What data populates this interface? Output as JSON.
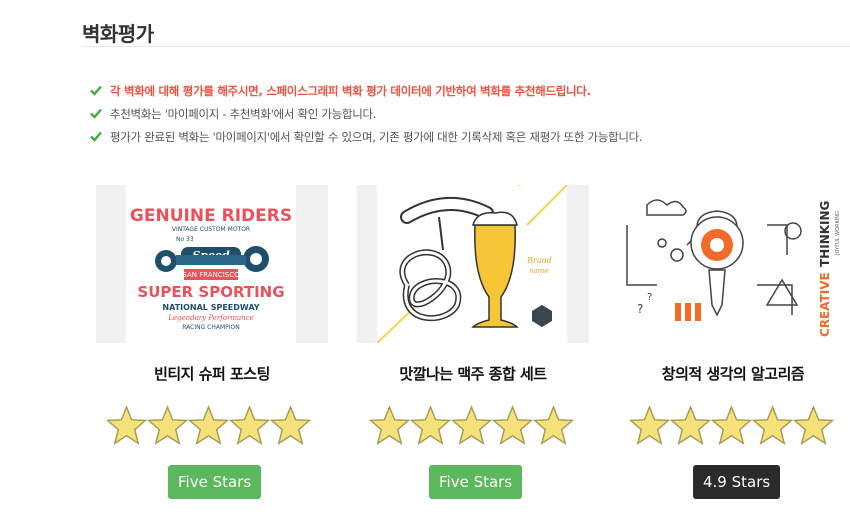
{
  "page": {
    "title": "벽화평가"
  },
  "notices": [
    {
      "text": "각 벽화에 대해 평가를 해주시면, 스페이스그래피 벽화 평가 데이터에 기반하여 벽화를 추천해드립니다.",
      "highlight": true
    },
    {
      "text": "추천벽화는 '마이페이지 - 추천벽화'에서 확인 가능합니다.",
      "highlight": false
    },
    {
      "text": "평가가 완료된 벽화는 '마이페이지'에서 확인할 수 있으며, 기존 평가에 대한 기록삭제 혹은 재평가 또한 가능합니다.",
      "highlight": false
    }
  ],
  "cards": [
    {
      "title": "빈티지 슈퍼 포스팅",
      "image": {
        "line1": "GENUINE RIDERS",
        "line2": "VINTAGE CUSTOM MOTOR",
        "badge": "Speed",
        "num_left": "No",
        "num_right": "33",
        "city": "SAN FRANCISCO",
        "headline": "SUPER SPORTING",
        "sub": "NATIONAL SPEEDWAY",
        "script": "Legendary Performance",
        "footer": "RACING CHAMPION"
      },
      "stars": 5,
      "rating_label": "Five Stars",
      "rating_color": "#5cb85c"
    },
    {
      "title": "맛깔나는 맥주 종합 세트",
      "image": {
        "brand1": "Brand",
        "brand2": "name"
      },
      "stars": 5,
      "rating_label": "Five Stars",
      "rating_color": "#5cb85c"
    },
    {
      "title": "창의적 생각의 알고리즘",
      "image": {
        "word1": "CREATIVE",
        "word2": "THINKING",
        "tag": "JOYFUL WORKING"
      },
      "stars": 5,
      "rating_label": "4.9 Stars",
      "rating_color": "#2b2b2b"
    }
  ],
  "colors": {
    "highlight": "#f0523f",
    "check": "#3cb034",
    "star_fill": "#f6e27a",
    "star_stroke": "#a89a52",
    "green_badge": "#5cb85c",
    "dark_badge": "#2b2b2b"
  },
  "icons": {
    "check": "check-icon",
    "star": "star-icon"
  }
}
